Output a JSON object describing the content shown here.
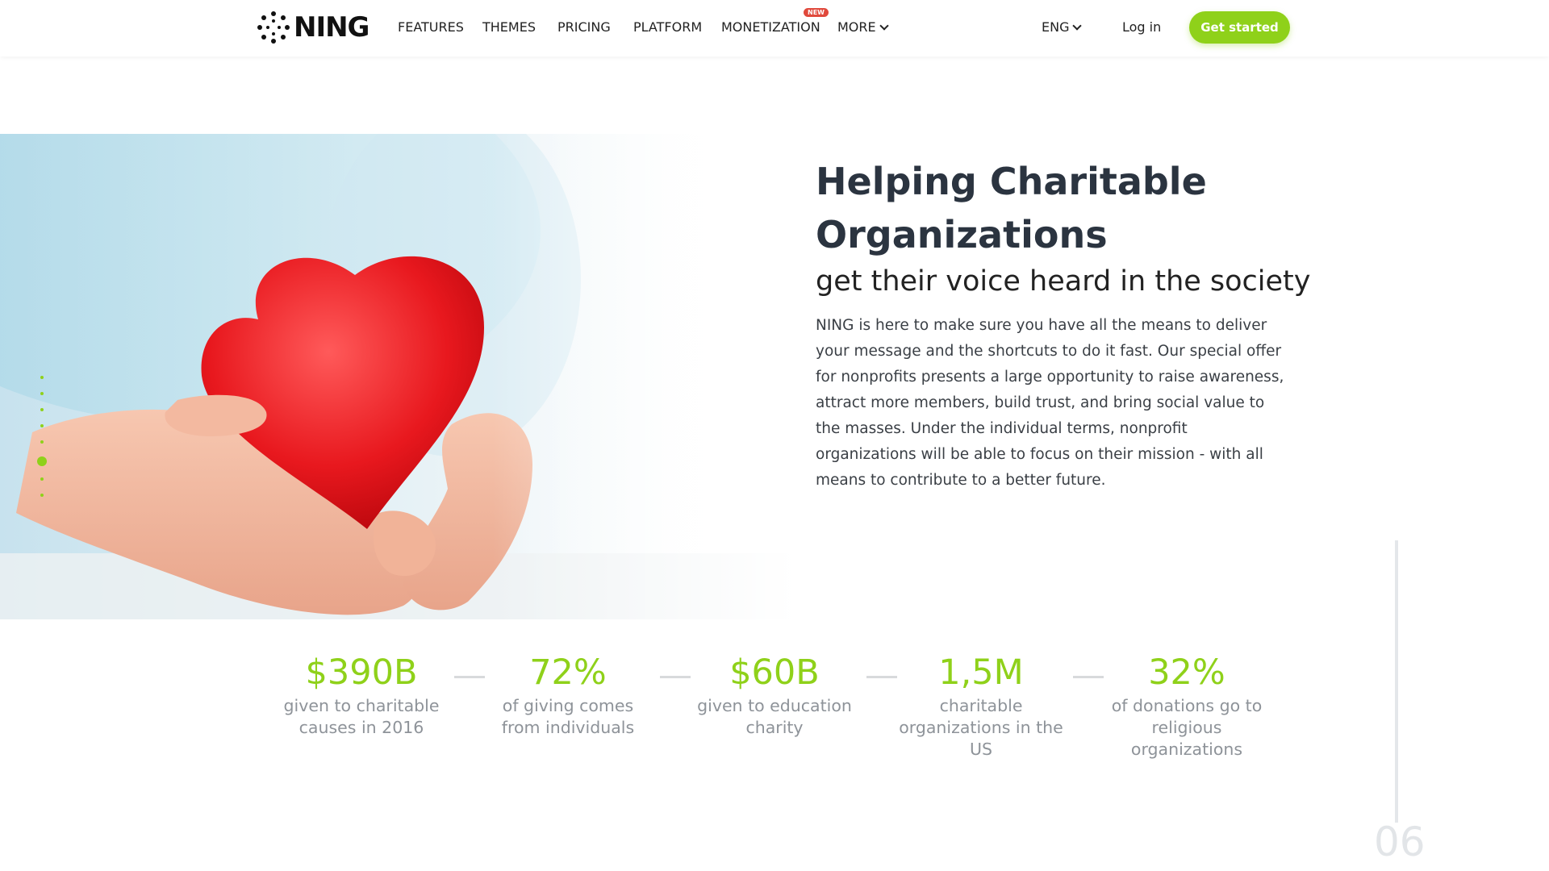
{
  "brand": {
    "name": "NING",
    "accent": "#8fd11a"
  },
  "nav": {
    "items": [
      {
        "label": "FEATURES"
      },
      {
        "label": "THEMES"
      },
      {
        "label": "PRICING"
      },
      {
        "label": "PLATFORM"
      },
      {
        "label": "MONETIZATION",
        "badge": "NEW"
      },
      {
        "label": "MORE"
      }
    ],
    "language": "ENG",
    "login": "Log in",
    "cta": "Get started"
  },
  "hero": {
    "title": "Helping Charitable Organizations",
    "subtitle": "get their voice heard in the society",
    "body": "NING is here to make sure you have all the means to deliver your message and the shortcuts to do it fast. Our special offer for nonprofits presents a large opportunity to raise awareness, attract more members, build trust, and bring social value to the masses. Under the individual terms, nonprofit organizations will be able to focus on their mission - with all means to contribute to a better future."
  },
  "side_nav": {
    "count": 8,
    "active_index": 5
  },
  "stats": [
    {
      "value": "$390B",
      "label": "given to charitable causes in 2016"
    },
    {
      "value": "72%",
      "label": "of giving comes from individuals"
    },
    {
      "value": "$60B",
      "label": "given to education charity"
    },
    {
      "value": "1,5M",
      "label": "charitable organizations in the US"
    },
    {
      "value": "32%",
      "label": "of donations go to religious organizations"
    }
  ],
  "section_number": "06"
}
